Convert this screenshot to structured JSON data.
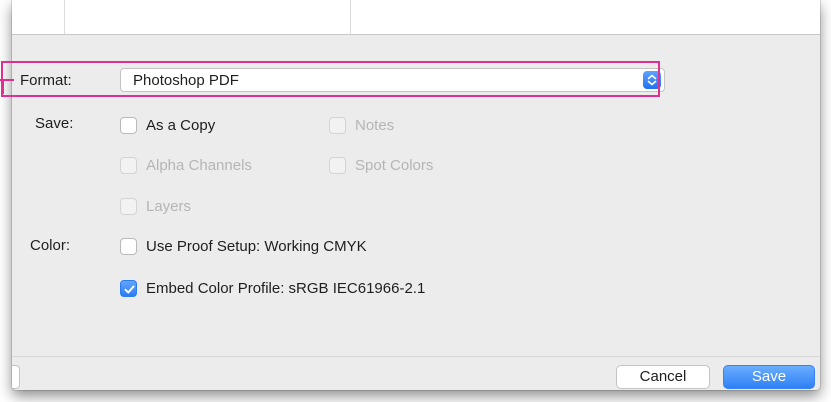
{
  "dialog": {
    "format": {
      "label": "Format:",
      "selected": "Photoshop PDF"
    },
    "save": {
      "label": "Save:",
      "options": [
        {
          "label": "As a Copy",
          "checked": false,
          "enabled": true
        },
        {
          "label": "Notes",
          "checked": false,
          "enabled": false
        },
        {
          "label": "Alpha Channels",
          "checked": false,
          "enabled": false
        },
        {
          "label": "Spot Colors",
          "checked": false,
          "enabled": false
        },
        {
          "label": "Layers",
          "checked": false,
          "enabled": false
        }
      ]
    },
    "color": {
      "label": "Color:",
      "options": [
        {
          "label": "Use Proof Setup:  Working CMYK",
          "checked": false,
          "enabled": true
        },
        {
          "label": "Embed Color Profile:  sRGB IEC61966-2.1",
          "checked": true,
          "enabled": true
        }
      ]
    },
    "buttons": {
      "cancel": "Cancel",
      "save": "Save"
    }
  },
  "colors": {
    "highlight": "#e0308f",
    "accent": "#2f80f5"
  },
  "icons": {
    "stepper": "up-down-chevron-icon",
    "checkmark": "checkmark-icon"
  }
}
